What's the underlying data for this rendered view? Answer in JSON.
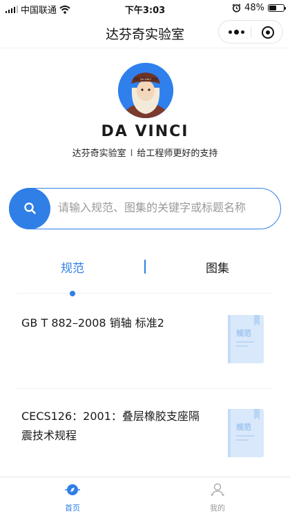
{
  "status_bar": {
    "carrier": "中国联通",
    "time": "下午3:03",
    "battery": "48%"
  },
  "nav": {
    "title": "达芬奇实验室"
  },
  "profile": {
    "brand": "DA VINCI",
    "tagline_left": "达芬奇实验室",
    "tagline_sep": "I",
    "tagline_right": "给工程师更好的支持",
    "avatar_badge": "DA VINCI"
  },
  "search": {
    "placeholder": "请输入规范、图集的关键字或标题名称"
  },
  "tabs": [
    {
      "label": "规范"
    },
    {
      "label": "图集"
    }
  ],
  "items": [
    {
      "title": "GB T 882–2008 销轴 标准2",
      "badge": "规范"
    },
    {
      "title": "CECS126：2001：叠层橡胶支座隔震技术规程",
      "badge": "规范"
    }
  ],
  "tabbar": {
    "home": "首页",
    "mine": "我的"
  },
  "colors": {
    "accent": "#2f7fe6",
    "book": "#d9e9fb"
  }
}
